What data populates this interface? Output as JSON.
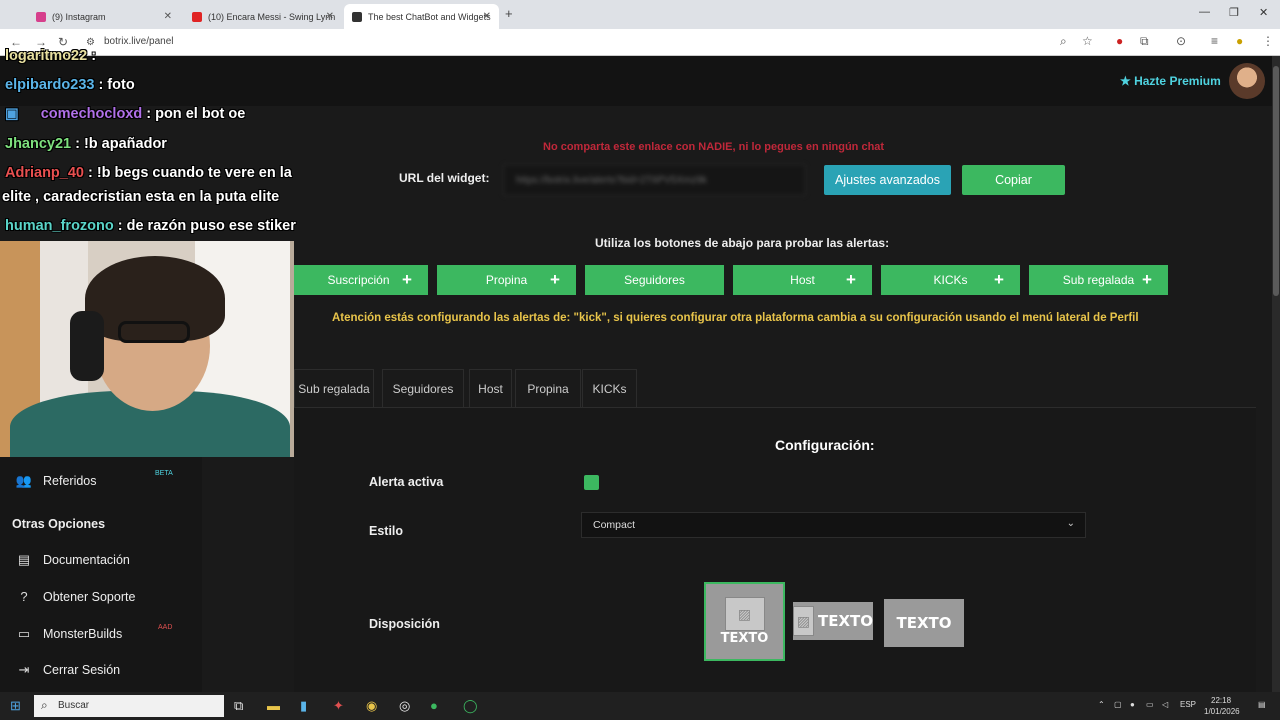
{
  "browser": {
    "tabs": [
      {
        "label": "(9) Instagram",
        "color": "#d63f8c"
      },
      {
        "label": "(10) Encara Messi - Swing Lynn",
        "color": "#e02424"
      },
      {
        "label": "The best ChatBot and Widgets",
        "color": "#333333"
      }
    ],
    "new_tab": "+",
    "url": "botrix.live/panel"
  },
  "topbar": {
    "premium_label": "Hazte Premium"
  },
  "sidebar": {
    "items_top": [
      {
        "label": "Referidos",
        "icon": "users-icon",
        "badge": "BETA"
      }
    ],
    "section_title": "Otras Opciones",
    "items": [
      {
        "label": "Documentación",
        "icon": "docs-icon"
      },
      {
        "label": "Obtener Soporte",
        "icon": "help-icon"
      },
      {
        "label": "MonsterBuilds",
        "icon": "monitor-icon",
        "badge": "AAD"
      },
      {
        "label": "Cerrar Sesión",
        "icon": "logout-icon"
      }
    ]
  },
  "main": {
    "warning_share": "No comparta este enlace con NADIE, ni lo pegues en ningún chat",
    "url_label": "URL del widget:",
    "url_value": "https://botrix.live/alerts?bid=2T6PV5Xmz9k",
    "advanced_button": "Ajustes avanzados",
    "copy_button": "Copiar",
    "hint": "Utiliza los botones de abajo para probar las alertas:",
    "test_buttons": [
      "Suscripción",
      "Propina",
      "Seguidores",
      "Host",
      "KICKs",
      "Sub regalada"
    ],
    "platform_warning": "Atención estás configurando las alertas de: \"kick\", si quieres configurar otra plataforma cambia a su configuración usando el menú lateral de Perfil",
    "subtabs": [
      "Sub regalada",
      "Seguidores",
      "Host",
      "Propina",
      "KICKs"
    ],
    "config_title": "Configuración:",
    "alert_active_label": "Alerta activa",
    "alert_active": true,
    "style_label": "Estilo",
    "style_value": "Compact",
    "layout_label": "Disposición",
    "layout_text": "TEXTO"
  },
  "overlay": {
    "chat": [
      {
        "user": "logaritmo22",
        "msg": ":",
        "color": "#e8e0a0"
      },
      {
        "user": "elpibardo233",
        "msg": ": foto",
        "color": "#5ab4e8"
      },
      {
        "user": "comechocloxd",
        "msg": ": pon el bot oe",
        "color": "#b070e8"
      },
      {
        "user": "Jhancy21",
        "msg": ": !b apañador",
        "color": "#7ee07e"
      },
      {
        "user": "Adrianp_40",
        "msg": ": !b begs cuando te vere en la",
        "color": "#e85050"
      },
      {
        "user": "",
        "msg": "elite , caradecristian esta en la puta elite",
        "color": "#ffffff"
      },
      {
        "user": "human_frozono",
        "msg": ": de razón puso ese stiker",
        "color": "#5ad4c8"
      }
    ]
  },
  "taskbar": {
    "search_placeholder": "Buscar",
    "lang": "ESP",
    "time": "22:18",
    "date": "1/01/2026"
  }
}
